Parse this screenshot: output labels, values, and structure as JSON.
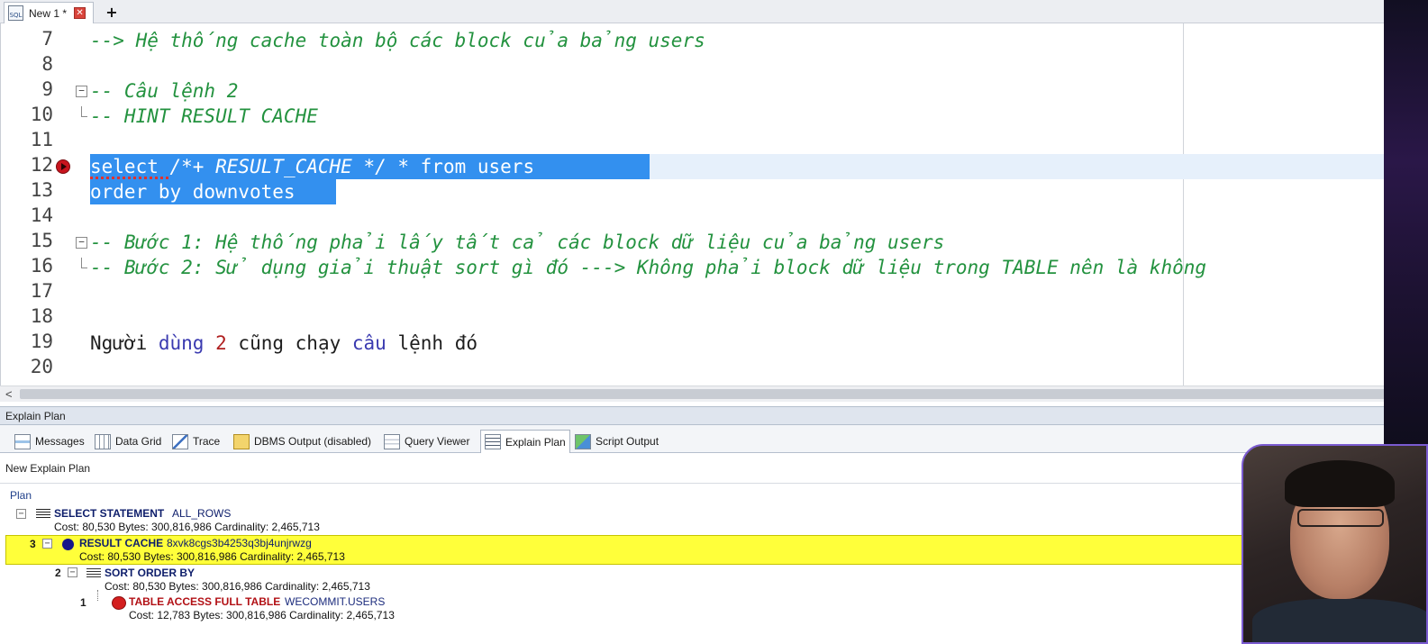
{
  "tab": {
    "icon": "sql-file-icon",
    "title": "New 1 *"
  },
  "editor": {
    "line_numbers": [
      "7",
      "8",
      "9",
      "10",
      "11",
      "12",
      "13",
      "14",
      "15",
      "16",
      "17",
      "18",
      "19",
      "20"
    ],
    "line7": "--> Hệ thống cache toàn bộ các block của bảng users",
    "line9": "-- Câu lệnh 2",
    "line10": "-- HINT RESULT CACHE",
    "line12_select": "select",
    "line12_comment": "/*+ RESULT_CACHE */",
    "line12_rest": " * from users",
    "line13": "order by downvotes",
    "line15": "-- Bước 1: Hệ thống phải lấy tất cả các block dữ liệu của bảng users",
    "line16": "-- Bước 2: Sử dụng giải thuật sort gì đó ---> Không phải block dữ liệu trong TABLE nên là không",
    "line19": {
      "w1": "Người",
      "w2": "dùng",
      "w3": "2",
      "w4": "cũng",
      "w5": "chạy",
      "w6": "câu",
      "w7": "lệnh",
      "w8": "đó"
    }
  },
  "panel": {
    "title": "Explain Plan",
    "tabs": [
      {
        "label": "Messages",
        "icon": "messages-icon"
      },
      {
        "label": "Data Grid",
        "icon": "data-grid-icon"
      },
      {
        "label": "Trace",
        "icon": "trace-icon"
      },
      {
        "label": "DBMS Output (disabled)",
        "icon": "dbms-output-icon"
      },
      {
        "label": "Query Viewer",
        "icon": "query-viewer-icon"
      },
      {
        "label": "Explain Plan",
        "icon": "explain-plan-icon"
      },
      {
        "label": "Script Output",
        "icon": "script-output-icon"
      }
    ],
    "active_tab": "Explain Plan",
    "new_plan_label": "New Explain Plan",
    "plan_header": "Plan",
    "rows": [
      {
        "step": "",
        "op": "SELECT STATEMENT",
        "obj": "ALL_ROWS",
        "stats": "Cost: 80,530  Bytes: 300,816,986  Cardinality: 2,465,713"
      },
      {
        "step": "3",
        "op": "RESULT CACHE",
        "obj": "8xvk8cgs3b4253q3bj4unjrwzg",
        "stats": "Cost: 80,530  Bytes: 300,816,986  Cardinality: 2,465,713"
      },
      {
        "step": "2",
        "op": "SORT ORDER BY",
        "obj": "",
        "stats": "Cost: 80,530  Bytes: 300,816,986  Cardinality: 2,465,713"
      },
      {
        "step": "1",
        "op": "TABLE ACCESS FULL TABLE",
        "obj": "WECOMMIT.USERS",
        "stats": "Cost: 12,783  Bytes: 300,816,986  Cardinality: 2,465,713"
      }
    ]
  },
  "colors": {
    "comment": "#23923f",
    "selection": "#3390ef",
    "highlight_row": "#ffff3a",
    "plan_op": "#0e1e6b",
    "plan_op_table": "#b21015"
  }
}
